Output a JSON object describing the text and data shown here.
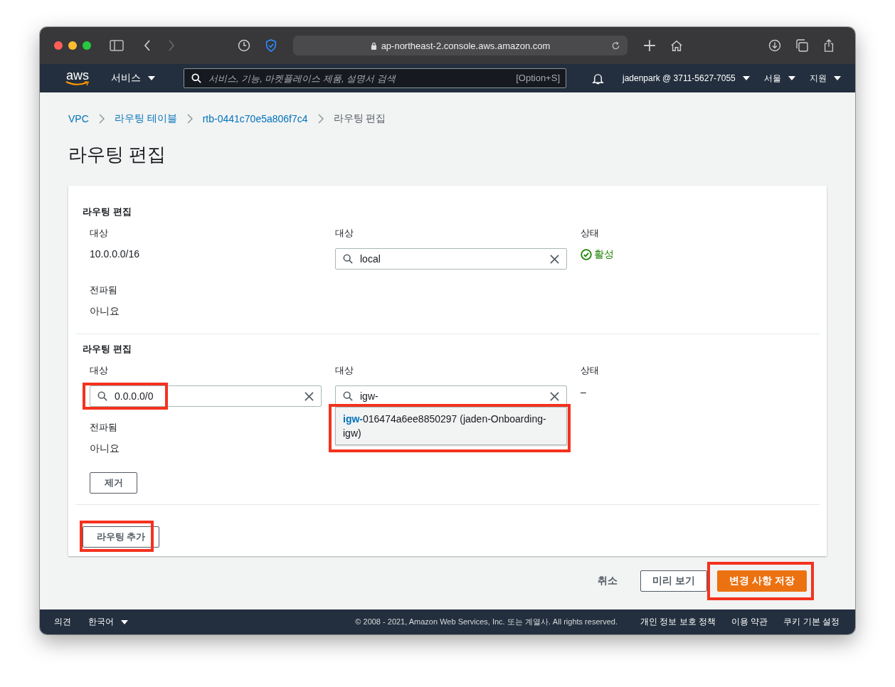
{
  "browser": {
    "url": "ap-northeast-2.console.aws.amazon.com"
  },
  "navbar": {
    "logo": "aws",
    "services": "서비스",
    "search": {
      "placeholder": "서비스, 기능, 마켓플레이스 제품, 설명서 검색",
      "shortcut": "[Option+S]"
    },
    "account": "jadenpark @ 3711-5627-7055",
    "region": "서울",
    "support": "지원"
  },
  "breadcrumb": [
    {
      "label": "VPC",
      "link": true
    },
    {
      "label": "라우팅 테이블",
      "link": true
    },
    {
      "label": "rtb-0441c70e5a806f7c4",
      "link": true
    },
    {
      "label": "라우팅 편집",
      "link": false
    }
  ],
  "title": "라우팅 편집",
  "routes": [
    {
      "heading": "라우팅 편집",
      "destination_label": "대상",
      "destination": {
        "kind": "text",
        "value": "10.0.0.0/16"
      },
      "target_label": "대상",
      "target": {
        "value": "local"
      },
      "status_label": "상태",
      "status": {
        "kind": "active",
        "text": "활성"
      },
      "propagated_label": "전파됨",
      "propagated": "아니요"
    },
    {
      "heading": "라우팅 편집",
      "destination_label": "대상",
      "destination": {
        "kind": "field",
        "value": "0.0.0.0/0",
        "highlighted": true
      },
      "target_label": "대상",
      "target": {
        "value": "igw-",
        "highlighted": true,
        "options": [
          "**igw-**016474a6ee8850297 (jaden-Onboarding-igw)"
        ]
      },
      "status_label": "상태",
      "status": {
        "kind": "none",
        "text": "–"
      },
      "propagated_label": "전파됨",
      "propagated": "아니요",
      "remove_button": "제거"
    }
  ],
  "add_button": {
    "label": "라우팅 추가",
    "highlighted": true
  },
  "actions": {
    "cancel": "취소",
    "preview": "미리 보기",
    "save": {
      "label": "변경 사항 저장",
      "highlighted": true
    }
  },
  "footer": {
    "feedback": "의견",
    "language": "한국어",
    "copyright": "© 2008 - 2021, Amazon Web Services, Inc. 또는 계열사. All rights reserved.",
    "links": [
      "개인 정보 보호 정책",
      "이용 약관",
      "쿠키 기본 설정"
    ]
  }
}
